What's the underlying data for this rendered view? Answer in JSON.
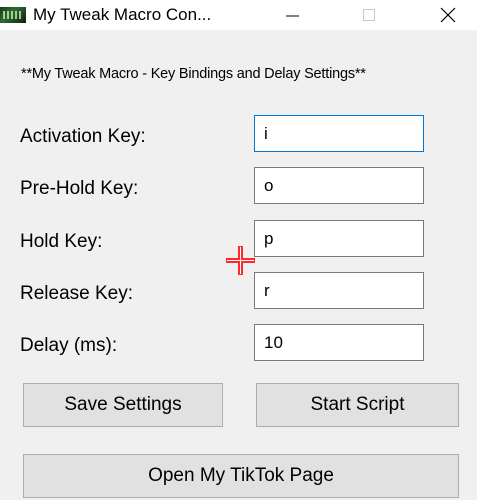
{
  "window": {
    "title": "My Tweak Macro Con...",
    "icon": "app-icon",
    "controls": [
      "minimize-icon",
      "maximize-icon",
      "close-icon"
    ]
  },
  "header": {
    "text": "**My Tweak Macro - Key Bindings and Delay Settings**"
  },
  "fields": {
    "activation": {
      "label": "Activation Key:",
      "value": "i"
    },
    "prehold": {
      "label": "Pre-Hold Key:",
      "value": "o"
    },
    "hold": {
      "label": "Hold Key:",
      "value": "p"
    },
    "release": {
      "label": "Release Key:",
      "value": "r"
    },
    "delay": {
      "label": "Delay (ms):",
      "value": "10"
    }
  },
  "buttons": {
    "save": "Save Settings",
    "start": "Start Script",
    "tiktok": "Open My TikTok Page"
  },
  "colors": {
    "focus_border": "#0078d7",
    "cursor": "#ff0000"
  },
  "cursor": {
    "icon": "crosshair-cursor-icon"
  }
}
